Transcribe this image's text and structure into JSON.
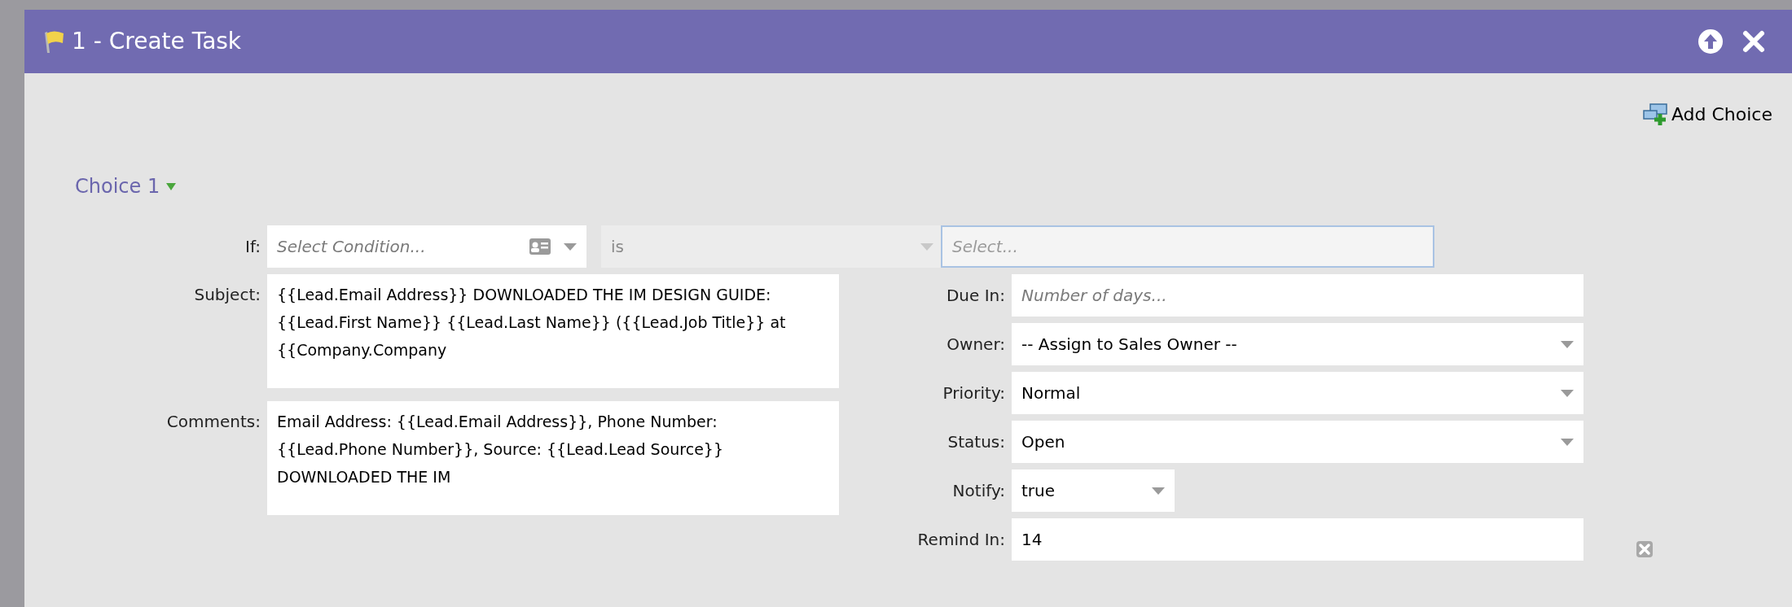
{
  "window": {
    "title": "1 - Create Task"
  },
  "toolbar": {
    "add_choice": "Add Choice"
  },
  "choice": {
    "label": "Choice 1",
    "expanded": true
  },
  "condition": {
    "label": "If:",
    "field": {
      "placeholder": "Select Condition..."
    },
    "operator": {
      "value": "is",
      "disabled": true
    },
    "value_field": {
      "placeholder": "Select...",
      "focused": true
    }
  },
  "left_fields": [
    {
      "label": "Subject:",
      "value": "{{Lead.Email Address}} DOWNLOADED THE IM DESIGN GUIDE: {{Lead.First Name}} {{Lead.Last Name}} ({{Lead.Job Title}} at {{Company.Company"
    },
    {
      "label": "Comments:",
      "value": "Email Address: {{Lead.Email Address}}, Phone Number: {{Lead.Phone Number}}, Source: {{Lead.Lead Source}} DOWNLOADED THE IM"
    }
  ],
  "right_fields": [
    {
      "label": "Due In:",
      "kind": "text",
      "placeholder": "Number of days..."
    },
    {
      "label": "Owner:",
      "kind": "select",
      "value": "-- Assign to Sales Owner --"
    },
    {
      "label": "Priority:",
      "kind": "select",
      "value": "Normal"
    },
    {
      "label": "Status:",
      "kind": "select",
      "value": "Open"
    },
    {
      "label": "Notify:",
      "kind": "small_select",
      "value": "true"
    },
    {
      "label": "Remind In:",
      "kind": "text",
      "value": "14",
      "removable": true
    }
  ]
}
